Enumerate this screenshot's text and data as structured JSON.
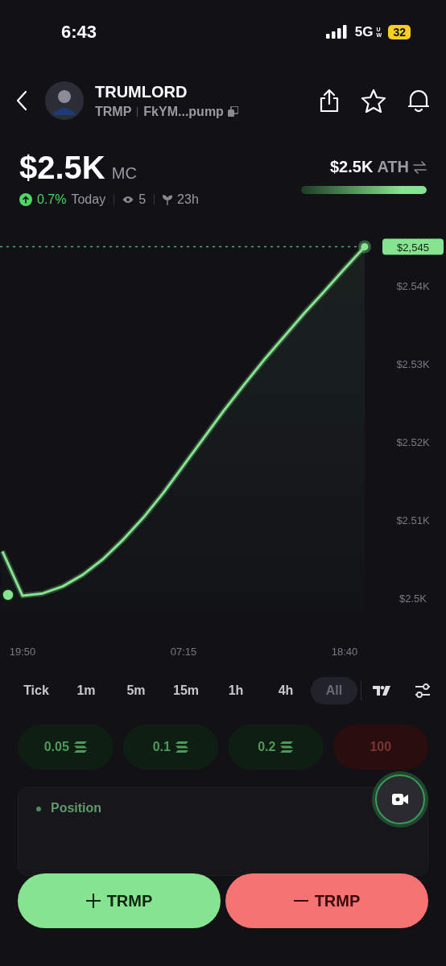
{
  "status_bar": {
    "time": "6:43",
    "network": "5G",
    "network_suffix": "UW",
    "battery": "32",
    "low_power": true
  },
  "token": {
    "name": "TRUMLORD",
    "symbol": "TRMP",
    "address": "FkYM...pump"
  },
  "header_actions": {
    "starred": false
  },
  "market_cap": {
    "value": "$2.5K",
    "unit": "MC",
    "change": "0.7%",
    "period": "Today",
    "views": "5",
    "age": "23h"
  },
  "ath": {
    "value": "$2.5K",
    "label": "ATH",
    "level": 1
  },
  "chart": {
    "chart_data": {
      "type": "area",
      "categories": [
        null,
        "19:50",
        null,
        null,
        null,
        null,
        null,
        null,
        null,
        "07:15",
        null,
        null,
        null,
        null,
        null,
        null,
        null,
        "18:40",
        null
      ],
      "series": [
        {
          "color": "#86e38f",
          "values": [
            2506,
            2500.3,
            2500.6,
            2501.5,
            2503,
            2505,
            2507.5,
            2510.3,
            2513.5,
            2517,
            2520.5,
            2524,
            2527.3,
            2530.5,
            2533.5,
            2536.5,
            2539.3,
            2542.2,
            2545
          ]
        }
      ],
      "ylim": [
        2500,
        2545
      ],
      "yticks": [
        {
          "value": 2500,
          "label": "$2.5K"
        },
        {
          "value": 2510,
          "label": "$2.51K"
        },
        {
          "value": 2520,
          "label": "$2.52K"
        },
        {
          "value": 2530,
          "label": "$2.53K"
        },
        {
          "value": 2540,
          "label": "$2.54K"
        }
      ],
      "annotations": [
        "$2,545"
      ]
    }
  },
  "timeframes": [
    {
      "label": "Tick",
      "selected": false
    },
    {
      "label": "1m",
      "selected": false
    },
    {
      "label": "5m",
      "selected": false
    },
    {
      "label": "15m",
      "selected": false
    },
    {
      "label": "1h",
      "selected": false
    },
    {
      "label": "4h",
      "selected": false
    },
    {
      "label": "All",
      "selected": true
    }
  ],
  "amounts": [
    {
      "label": "0.05",
      "kind": "buy"
    },
    {
      "label": "0.1",
      "kind": "buy"
    },
    {
      "label": "0.2",
      "kind": "buy"
    },
    {
      "label": "100",
      "kind": "sell"
    }
  ],
  "position": {
    "title": "Position"
  },
  "actions": [
    {
      "label": "TRMP",
      "kind": "buy"
    },
    {
      "label": "TRMP",
      "kind": "sell"
    }
  ]
}
